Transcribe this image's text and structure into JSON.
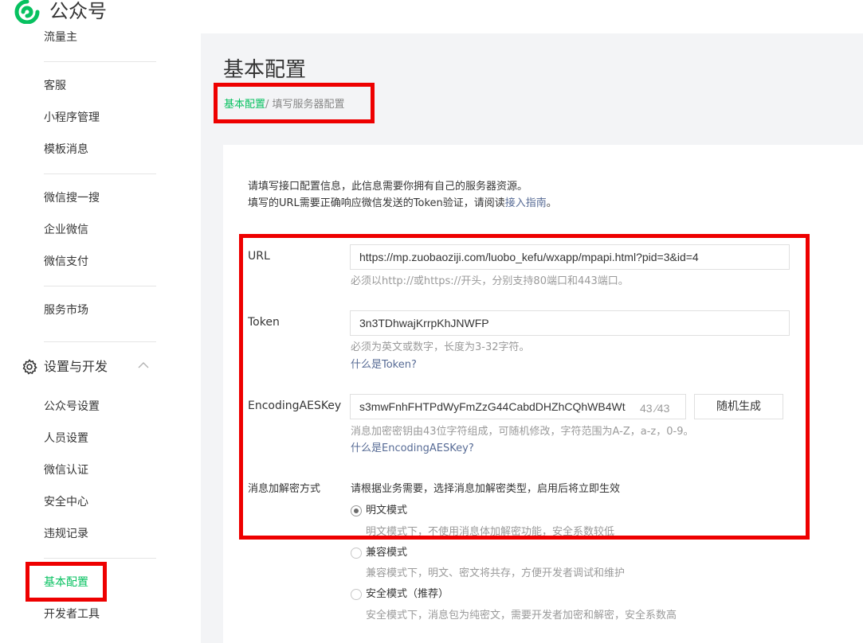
{
  "brand": {
    "name": "公众号"
  },
  "sidebar": {
    "items": [
      {
        "label": "流量主"
      },
      {
        "label": "客服"
      },
      {
        "label": "小程序管理"
      },
      {
        "label": "模板消息"
      },
      {
        "label": "微信搜一搜"
      },
      {
        "label": "企业微信"
      },
      {
        "label": "微信支付"
      },
      {
        "label": "服务市场"
      }
    ],
    "section": {
      "label": "设置与开发",
      "icon": "gear-icon",
      "items": [
        {
          "label": "公众号设置"
        },
        {
          "label": "人员设置"
        },
        {
          "label": "微信认证"
        },
        {
          "label": "安全中心"
        },
        {
          "label": "违规记录"
        },
        {
          "label": "基本配置",
          "active": true
        },
        {
          "label": "开发者工具"
        }
      ]
    }
  },
  "main": {
    "title": "基本配置",
    "breadcrumb": {
      "current": "基本配置",
      "separator": "/",
      "next": "填写服务器配置"
    },
    "intro": {
      "line1": "请填写接口配置信息，此信息需要你拥有自己的服务器资源。",
      "line2_prefix": "填写的URL需要正确响应微信发送的Token验证，请阅读",
      "line2_link": "接入指南",
      "line2_suffix": "。"
    },
    "form": {
      "url": {
        "label": "URL",
        "value": "https://mp.zuobaoziji.com/luobo_kefu/wxapp/mpapi.html?pid=3&id=4",
        "tip": "必须以http://或https://开头，分别支持80端口和443端口。"
      },
      "token": {
        "label": "Token",
        "value": "3n3TDhwajKrrpKhJNWFP",
        "tip": "必须为英文或数字，长度为3-32字符。",
        "help": "什么是Token?"
      },
      "aes": {
        "label": "EncodingAESKey",
        "value": "s3mwFnhFHTPdWyFmZzG44CabdDHZhCQhWB4Wt",
        "counter": "43 ∕43",
        "generate": "随机生成",
        "tip": "消息加密密钥由43位字符组成，可随机修改，字符范围为A-Z，a-z，0-9。",
        "help": "什么是EncodingAESKey?"
      },
      "mode": {
        "label": "消息加解密方式",
        "hint": "请根据业务需要，选择消息加解密类型，启用后将立即生效",
        "options": [
          {
            "label": "明文模式",
            "desc": "明文模式下，不使用消息体加解密功能，安全系数较低",
            "checked": true
          },
          {
            "label": "兼容模式",
            "desc": "兼容模式下，明文、密文将共存，方便开发者调试和维护",
            "checked": false
          },
          {
            "label": "安全模式（推荐）",
            "desc": "安全模式下，消息包为纯密文，需要开发者加密和解密，安全系数高",
            "checked": false
          }
        ]
      }
    }
  },
  "annotations": {
    "highlight_color": "#ee0000"
  },
  "colors": {
    "accent": "#07c160",
    "link": "#576b95"
  }
}
